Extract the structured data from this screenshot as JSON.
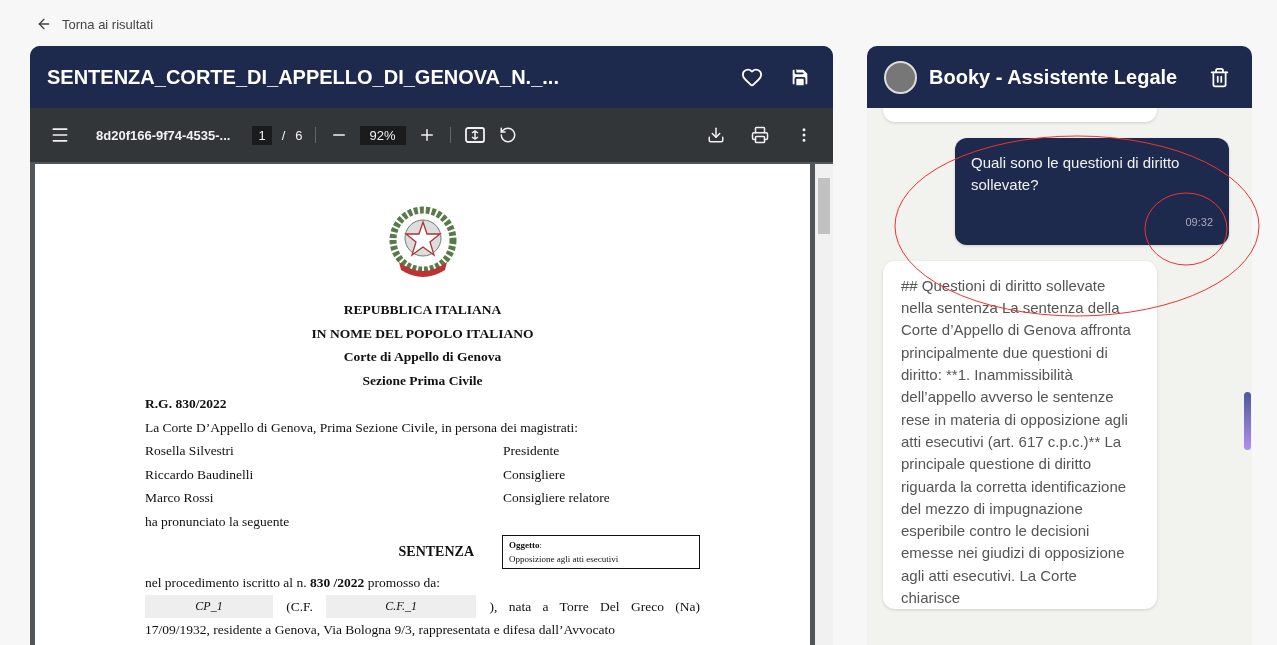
{
  "back_link": {
    "label": "Torna ai risultati"
  },
  "document_panel": {
    "title": "SENTENZA_CORTE_DI_APPELLO_DI_GENOVA_N._...",
    "toolbar": {
      "file_name": "8d20f166-9f74-4535-...",
      "page": "1",
      "page_separator": "/",
      "page_count": "6",
      "zoom": "92%"
    },
    "page": {
      "heading": [
        "REPUBBLICA ITALIANA",
        "IN NOME DEL POPOLO ITALIANO",
        "Corte di Appello di Genova",
        "Sezione Prima Civile"
      ],
      "case_number": "R.G. 830/2022",
      "intro": "La Corte D’Appello di Genova, Prima Sezione Civile, in persona dei magistrati:",
      "magistrates": [
        {
          "name": "Rosella Silvestri",
          "role": "Presidente"
        },
        {
          "name": "Riccardo Baudinelli",
          "role": "Consigliere"
        },
        {
          "name": "Marco Rossi",
          "role": "Consigliere relatore"
        }
      ],
      "pronounced": "ha pronunciato la seguente",
      "verdict_title": "SENTENZA",
      "subject": {
        "label": "Oggetto",
        "separator": ":",
        "text": "Opposizione agli atti esecutivi"
      },
      "proceeding": "nel procedimento iscritto al n. **830 /2022** promosso da:",
      "party": {
        "name": "CP_1",
        "cf_label": "(C.F.",
        "cf": "C.F._1",
        "rest": "), nata a Torre Del Greco (Na)"
      },
      "continuation": "17/09/1932, residente a Genova, Via Bologna 9/3, rappresentata e difesa dall’Avvocato"
    }
  },
  "chat_panel": {
    "title": "Booky - Assistente Legale",
    "messages": [
      {
        "kind": "assistant"
      },
      {
        "kind": "user",
        "text": "Quali sono le questioni di diritto sollevate?",
        "time": "09:32"
      },
      {
        "kind": "assistant",
        "text": "## Questioni di diritto sollevate nella sentenza La sentenza della Corte d’Appello di Genova affronta principalmente due questioni di diritto: **1. Inammissibilità dell’appello avverso le sentenze rese in materia di opposizione agli atti esecutivi (art. 617 c.p.c.)** La principale questione di diritto riguarda la corretta identificazione del mezzo di impugnazione esperibile contro le decisioni emesse nei giudizi di opposizione agli atti esecutivi. La Corte chiarisce"
      }
    ]
  }
}
